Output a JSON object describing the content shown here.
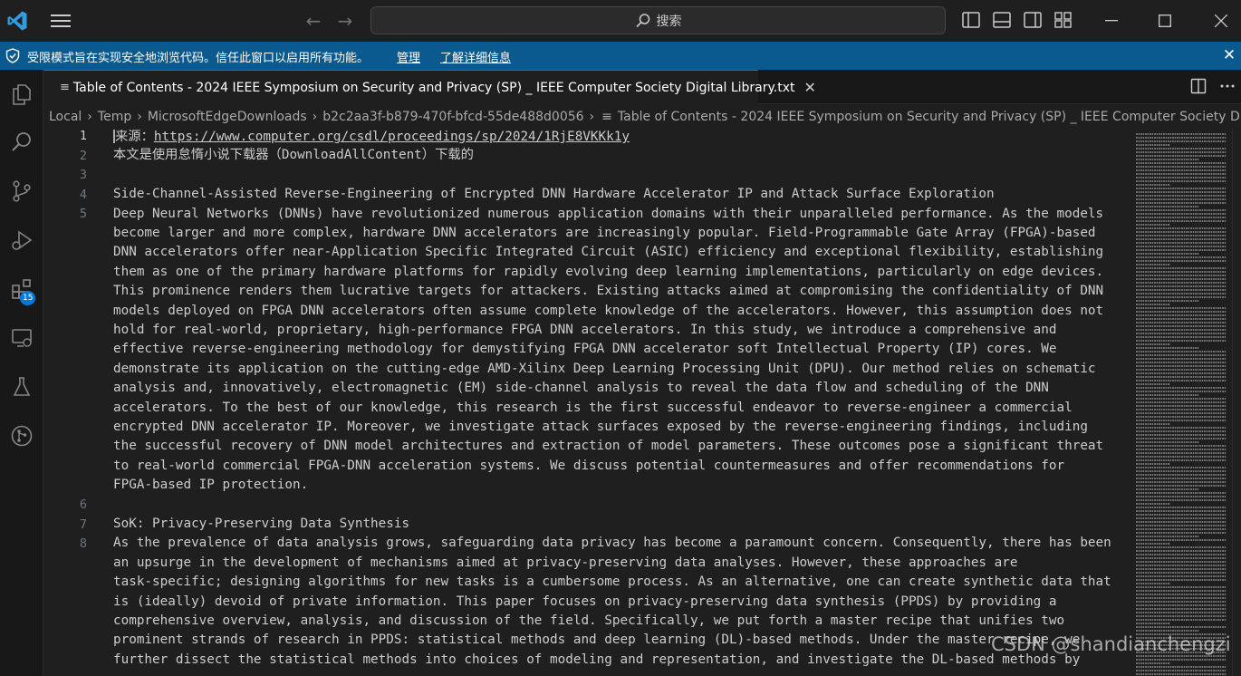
{
  "titlebar": {
    "search_label": "搜索"
  },
  "banner": {
    "message": "受限模式旨在实现安全地浏览代码。信任此窗口以启用所有功能。",
    "manage_link": "管理",
    "learn_more_link": "了解详细信息"
  },
  "activitybar": {
    "extensions_badge": "15"
  },
  "tab": {
    "label": "Table of Contents - 2024 IEEE Symposium on Security and Privacy (SP) _ IEEE Computer Society Digital Library.txt"
  },
  "breadcrumb": {
    "items": [
      "Local",
      "Temp",
      "MicrosoftEdgeDownloads",
      "b2c2aa3f-b879-470f-bfcd-55de488d0056",
      "Table of Contents - 2024 IEEE Symposium on Security and Privacy (SP) _ IEEE Computer Society Digital Library.txt"
    ]
  },
  "editor": {
    "line_numbers": [
      "1",
      "2",
      "3",
      "4",
      "5",
      "6",
      "7",
      "8"
    ],
    "line1_prefix": "来源：",
    "line1_url": "https://www.computer.org/csdl/proceedings/sp/2024/1RjE8VKKk1y",
    "rows": [
      "本文是使用怠惰小说下载器（DownloadAllContent）下载的",
      "",
      "Side-Channel-Assisted Reverse-Engineering of Encrypted DNN Hardware Accelerator IP and Attack Surface Exploration",
      "Deep Neural Networks (DNNs) have revolutionized numerous application domains with their unparalleled performance. As the models",
      "become larger and more complex, hardware DNN accelerators are increasingly popular. Field-Programmable Gate Array (FPGA)-based",
      "DNN accelerators offer near-Application Specific Integrated Circuit (ASIC) efficiency and exceptional flexibility, establishing",
      "them as one of the primary hardware platforms for rapidly evolving deep learning implementations, particularly on edge devices.",
      "This prominence renders them lucrative targets for attackers. Existing attacks aimed at compromising the confidentiality of DNN",
      "models deployed on FPGA DNN accelerators often assume complete knowledge of the accelerators. However, this assumption does not",
      "hold for real-world, proprietary, high-performance FPGA DNN accelerators. In this study, we introduce a comprehensive and",
      "effective reverse-engineering methodology for demystifying FPGA DNN accelerator soft Intellectual Property (IP) cores. We",
      "demonstrate its application on the cutting-edge AMD-Xilinx Deep Learning Processing Unit (DPU). Our method relies on schematic",
      "analysis and, innovatively, electromagnetic (EM) side-channel analysis to reveal the data flow and scheduling of the DNN",
      "accelerators. To the best of our knowledge, this research is the first successful endeavor to reverse-engineer a commercial",
      "encrypted DNN accelerator IP. Moreover, we investigate attack surfaces exposed by the reverse-engineering findings, including",
      "the successful recovery of DNN model architectures and extraction of model parameters. These outcomes pose a significant threat",
      "to real-world commercial FPGA-DNN acceleration systems. We discuss potential countermeasures and offer recommendations for",
      "FPGA-based IP protection.",
      "",
      "SoK: Privacy-Preserving Data Synthesis",
      "As the prevalence of data analysis grows, safeguarding data privacy has become a paramount concern. Consequently, there has been",
      "an upsurge in the development of mechanisms aimed at privacy-preserving data analyses. However, these approaches are",
      "task-specific; designing algorithms for new tasks is a cumbersome process. As an alternative, one can create synthetic data that",
      "is (ideally) devoid of private information. This paper focuses on privacy-preserving data synthesis (PPDS) by providing a",
      "comprehensive overview, analysis, and discussion of the field. Specifically, we put forth a master recipe that unifies two",
      "prominent strands of research in PPDS: statistical methods and deep learning (DL)-based methods. Under the master recipe, we",
      "further dissect the statistical methods into choices of modeling and representation, and investigate the DL-based methods by"
    ]
  },
  "watermark": "CSDN @shandianchengzi"
}
